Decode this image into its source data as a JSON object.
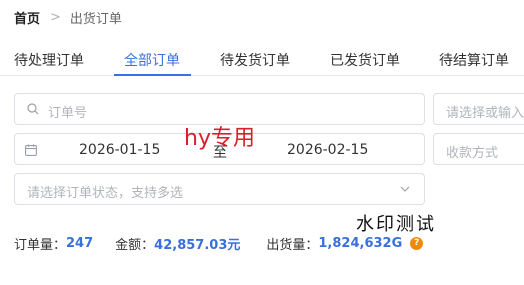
{
  "breadcrumb": {
    "home": "首页",
    "current": "出货订单"
  },
  "tabs": [
    {
      "label": "待处理订单",
      "active": false
    },
    {
      "label": "全部订单",
      "active": true
    },
    {
      "label": "待发货订单",
      "active": false
    },
    {
      "label": "已发货订单",
      "active": false
    },
    {
      "label": "待结算订单",
      "active": false
    }
  ],
  "filters": {
    "order_no_placeholder": "订单号",
    "right_select_placeholder": "请选择或输入",
    "date_start": "2026-01-15",
    "date_separator": "至",
    "date_end": "2026-02-15",
    "payment_placeholder": "收款方式",
    "status_placeholder": "请选择订单状态，支持多选"
  },
  "watermarks": {
    "overlay_text": "hy专用",
    "overlay_text_2": "水印测试"
  },
  "stats": {
    "order_count_label": "订单量：",
    "order_count_value": "247",
    "amount_label": "金额：",
    "amount_value": "42,857.03元",
    "shipped_label": "出货量：",
    "shipped_value": "1,824,632G"
  },
  "colors": {
    "accent": "#3a6fe0",
    "watermark_red": "#d9202a",
    "help_orange": "#f08a0e"
  },
  "icons": [
    "chevron-right-icon",
    "search-icon",
    "calendar-icon",
    "chevron-down-icon",
    "question-icon"
  ]
}
